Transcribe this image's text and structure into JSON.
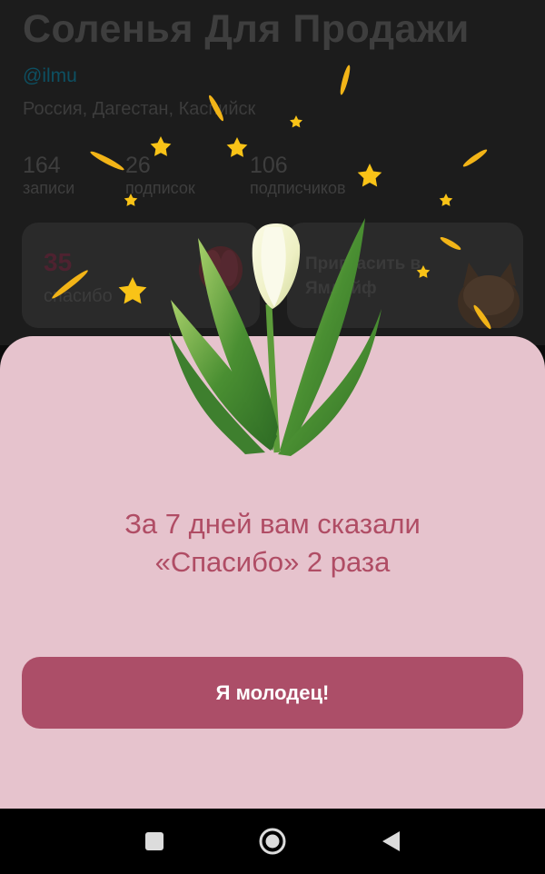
{
  "profile": {
    "name": "Соленья Для Продажи",
    "handle": "@ilmu",
    "location": "Россия, Дагестан, Каспийск",
    "stats": [
      {
        "count": "164",
        "label": "записи"
      },
      {
        "count": "26",
        "label": "подписок"
      },
      {
        "count": "106",
        "label": "подписчиков"
      }
    ],
    "cards": {
      "thanks_count": "35",
      "thanks_label": "спасибо",
      "invite_label": "Пригласить в Ямлайф"
    }
  },
  "sheet": {
    "message_line1": "За 7 дней вам сказали",
    "message_line2": "«Спасибо» 2 раза",
    "button_label": "Я молодец!"
  },
  "navbar": {
    "items": [
      "recent-apps",
      "home",
      "back"
    ]
  },
  "colors": {
    "sheet_bg": "#e6c3cd",
    "accent": "#ac4e68",
    "message_text": "#b04d65",
    "star": "#f9c317"
  }
}
